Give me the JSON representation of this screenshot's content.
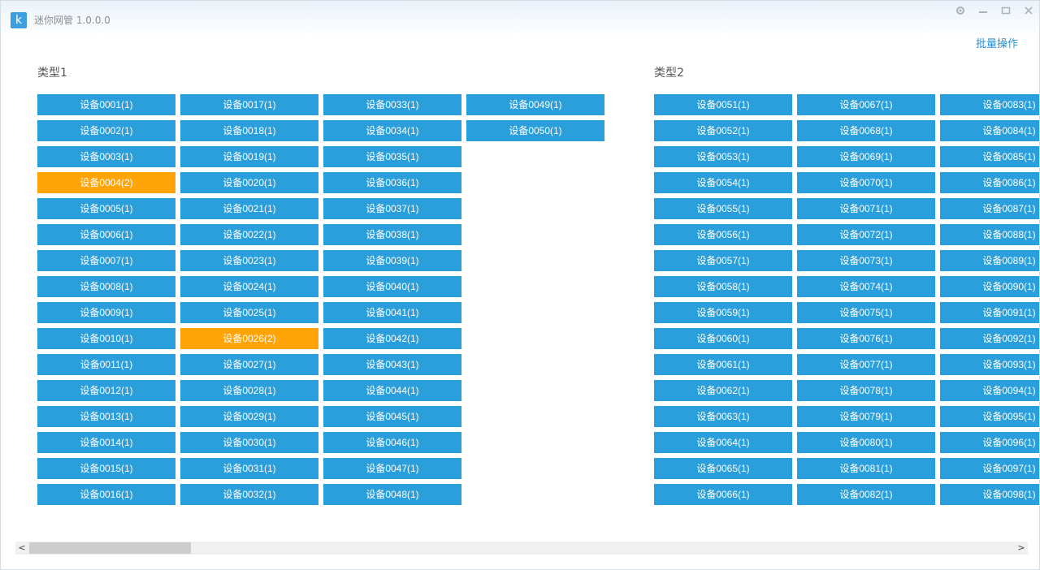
{
  "window": {
    "title": "迷你网管 1.0.0.0",
    "app_icon_glyph": "k",
    "controls": [
      "settings-icon",
      "minimize-icon",
      "maximize-icon",
      "close-icon"
    ]
  },
  "toolbar": {
    "batch_label": "批量操作"
  },
  "colors": {
    "normal": "#2a9fdc",
    "alert": "#ffa406",
    "link": "#2b8fd0"
  },
  "groups": [
    {
      "label": "类型1",
      "columns": [
        [
          {
            "name": "设备0001(1)",
            "alert": false
          },
          {
            "name": "设备0002(1)",
            "alert": false
          },
          {
            "name": "设备0003(1)",
            "alert": false
          },
          {
            "name": "设备0004(2)",
            "alert": true
          },
          {
            "name": "设备0005(1)",
            "alert": false
          },
          {
            "name": "设备0006(1)",
            "alert": false
          },
          {
            "name": "设备0007(1)",
            "alert": false
          },
          {
            "name": "设备0008(1)",
            "alert": false
          },
          {
            "name": "设备0009(1)",
            "alert": false
          },
          {
            "name": "设备0010(1)",
            "alert": false
          },
          {
            "name": "设备0011(1)",
            "alert": false
          },
          {
            "name": "设备0012(1)",
            "alert": false
          },
          {
            "name": "设备0013(1)",
            "alert": false
          },
          {
            "name": "设备0014(1)",
            "alert": false
          },
          {
            "name": "设备0015(1)",
            "alert": false
          },
          {
            "name": "设备0016(1)",
            "alert": false
          }
        ],
        [
          {
            "name": "设备0017(1)",
            "alert": false
          },
          {
            "name": "设备0018(1)",
            "alert": false
          },
          {
            "name": "设备0019(1)",
            "alert": false
          },
          {
            "name": "设备0020(1)",
            "alert": false
          },
          {
            "name": "设备0021(1)",
            "alert": false
          },
          {
            "name": "设备0022(1)",
            "alert": false
          },
          {
            "name": "设备0023(1)",
            "alert": false
          },
          {
            "name": "设备0024(1)",
            "alert": false
          },
          {
            "name": "设备0025(1)",
            "alert": false
          },
          {
            "name": "设备0026(2)",
            "alert": true
          },
          {
            "name": "设备0027(1)",
            "alert": false
          },
          {
            "name": "设备0028(1)",
            "alert": false
          },
          {
            "name": "设备0029(1)",
            "alert": false
          },
          {
            "name": "设备0030(1)",
            "alert": false
          },
          {
            "name": "设备0031(1)",
            "alert": false
          },
          {
            "name": "设备0032(1)",
            "alert": false
          }
        ],
        [
          {
            "name": "设备0033(1)",
            "alert": false
          },
          {
            "name": "设备0034(1)",
            "alert": false
          },
          {
            "name": "设备0035(1)",
            "alert": false
          },
          {
            "name": "设备0036(1)",
            "alert": false
          },
          {
            "name": "设备0037(1)",
            "alert": false
          },
          {
            "name": "设备0038(1)",
            "alert": false
          },
          {
            "name": "设备0039(1)",
            "alert": false
          },
          {
            "name": "设备0040(1)",
            "alert": false
          },
          {
            "name": "设备0041(1)",
            "alert": false
          },
          {
            "name": "设备0042(1)",
            "alert": false
          },
          {
            "name": "设备0043(1)",
            "alert": false
          },
          {
            "name": "设备0044(1)",
            "alert": false
          },
          {
            "name": "设备0045(1)",
            "alert": false
          },
          {
            "name": "设备0046(1)",
            "alert": false
          },
          {
            "name": "设备0047(1)",
            "alert": false
          },
          {
            "name": "设备0048(1)",
            "alert": false
          }
        ],
        [
          {
            "name": "设备0049(1)",
            "alert": false
          },
          {
            "name": "设备0050(1)",
            "alert": false
          }
        ]
      ]
    },
    {
      "label": "类型2",
      "columns": [
        [
          {
            "name": "设备0051(1)",
            "alert": false
          },
          {
            "name": "设备0052(1)",
            "alert": false
          },
          {
            "name": "设备0053(1)",
            "alert": false
          },
          {
            "name": "设备0054(1)",
            "alert": false
          },
          {
            "name": "设备0055(1)",
            "alert": false
          },
          {
            "name": "设备0056(1)",
            "alert": false
          },
          {
            "name": "设备0057(1)",
            "alert": false
          },
          {
            "name": "设备0058(1)",
            "alert": false
          },
          {
            "name": "设备0059(1)",
            "alert": false
          },
          {
            "name": "设备0060(1)",
            "alert": false
          },
          {
            "name": "设备0061(1)",
            "alert": false
          },
          {
            "name": "设备0062(1)",
            "alert": false
          },
          {
            "name": "设备0063(1)",
            "alert": false
          },
          {
            "name": "设备0064(1)",
            "alert": false
          },
          {
            "name": "设备0065(1)",
            "alert": false
          },
          {
            "name": "设备0066(1)",
            "alert": false
          }
        ],
        [
          {
            "name": "设备0067(1)",
            "alert": false
          },
          {
            "name": "设备0068(1)",
            "alert": false
          },
          {
            "name": "设备0069(1)",
            "alert": false
          },
          {
            "name": "设备0070(1)",
            "alert": false
          },
          {
            "name": "设备0071(1)",
            "alert": false
          },
          {
            "name": "设备0072(1)",
            "alert": false
          },
          {
            "name": "设备0073(1)",
            "alert": false
          },
          {
            "name": "设备0074(1)",
            "alert": false
          },
          {
            "name": "设备0075(1)",
            "alert": false
          },
          {
            "name": "设备0076(1)",
            "alert": false
          },
          {
            "name": "设备0077(1)",
            "alert": false
          },
          {
            "name": "设备0078(1)",
            "alert": false
          },
          {
            "name": "设备0079(1)",
            "alert": false
          },
          {
            "name": "设备0080(1)",
            "alert": false
          },
          {
            "name": "设备0081(1)",
            "alert": false
          },
          {
            "name": "设备0082(1)",
            "alert": false
          }
        ],
        [
          {
            "name": "设备0083(1)",
            "alert": false
          },
          {
            "name": "设备0084(1)",
            "alert": false
          },
          {
            "name": "设备0085(1)",
            "alert": false
          },
          {
            "name": "设备0086(1)",
            "alert": false
          },
          {
            "name": "设备0087(1)",
            "alert": false
          },
          {
            "name": "设备0088(1)",
            "alert": false
          },
          {
            "name": "设备0089(1)",
            "alert": false
          },
          {
            "name": "设备0090(1)",
            "alert": false
          },
          {
            "name": "设备0091(1)",
            "alert": false
          },
          {
            "name": "设备0092(1)",
            "alert": false
          },
          {
            "name": "设备0093(1)",
            "alert": false
          },
          {
            "name": "设备0094(1)",
            "alert": false
          },
          {
            "name": "设备0095(1)",
            "alert": false
          },
          {
            "name": "设备0096(1)",
            "alert": false
          },
          {
            "name": "设备0097(1)",
            "alert": false
          },
          {
            "name": "设备0098(1)",
            "alert": false
          }
        ]
      ]
    }
  ],
  "scrollbar": {
    "left_arrow": "<",
    "right_arrow": ">",
    "position_fraction": 0.0
  }
}
